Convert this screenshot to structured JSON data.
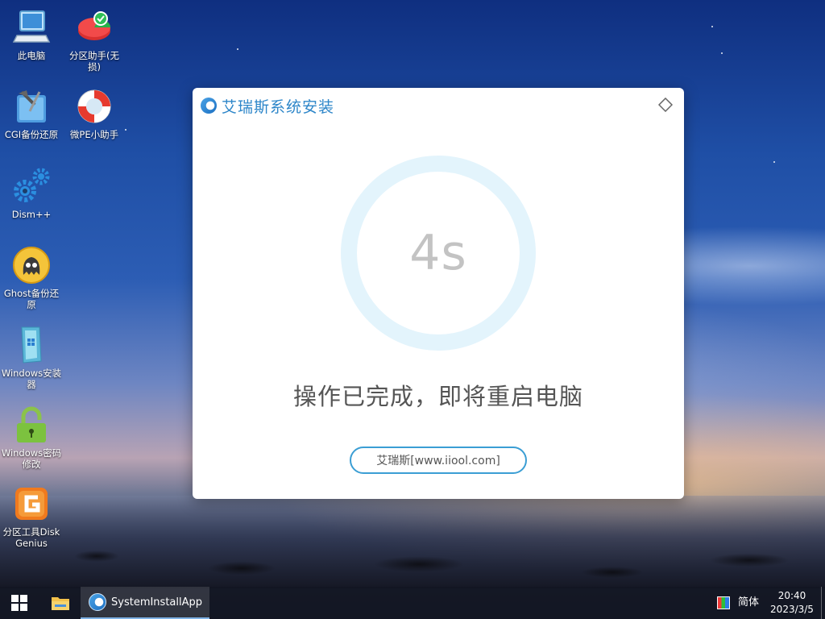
{
  "desktop": {
    "icons": [
      {
        "label": "此电脑",
        "icon": "computer-icon"
      },
      {
        "label": "分区助手(无损)",
        "icon": "partition-assistant-icon"
      },
      {
        "label": "CGI备份还原",
        "icon": "cgi-backup-icon"
      },
      {
        "label": "微PE小助手",
        "icon": "lifebuoy-icon"
      },
      {
        "label": "Dism++",
        "icon": "gears-icon"
      },
      {
        "label": "Ghost备份还原",
        "icon": "ghost-icon"
      },
      {
        "label": "Windows安装器",
        "icon": "windows-installer-icon"
      },
      {
        "label": "Windows密码修改",
        "icon": "padlock-icon"
      },
      {
        "label": "分区工具DiskGenius",
        "icon": "diskgenius-icon"
      }
    ]
  },
  "dialog": {
    "title": "艾瑞斯系统安装",
    "countdown": "4s",
    "status_message": "操作已完成，即将重启电脑",
    "site_button": "艾瑞斯[www.iiool.com]",
    "pin_icon": "pin-icon",
    "accent_color": "#2d86c9"
  },
  "taskbar": {
    "start_icon": "windows-start-icon",
    "explorer_icon": "folder-icon",
    "active_app": "SystemInstallApp",
    "language": "简体",
    "time": "20:40",
    "date": "2023/3/5"
  }
}
